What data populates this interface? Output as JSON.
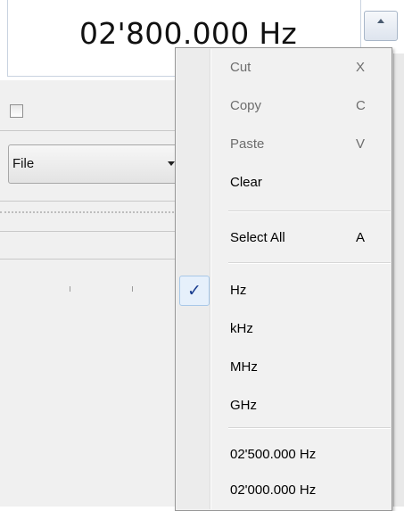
{
  "frequency_display": {
    "value": "02'800.000 Hz"
  },
  "file_combo": {
    "label": "File"
  },
  "context_menu": {
    "items_edit": [
      {
        "label": "Cut",
        "shortcut": "X",
        "enabled": false
      },
      {
        "label": "Copy",
        "shortcut": "C",
        "enabled": false
      },
      {
        "label": "Paste",
        "shortcut": "V",
        "enabled": false
      },
      {
        "label": "Clear",
        "shortcut": "",
        "enabled": true
      }
    ],
    "select_all": {
      "label": "Select All",
      "shortcut": "A"
    },
    "units": [
      {
        "label": "Hz",
        "checked": true
      },
      {
        "label": "kHz",
        "checked": false
      },
      {
        "label": "MHz",
        "checked": false
      },
      {
        "label": "GHz",
        "checked": false
      }
    ],
    "presets": [
      {
        "label": "02'500.000 Hz"
      },
      {
        "label": "02'000.000 Hz"
      }
    ],
    "check_glyph": "✓"
  },
  "colors": {
    "menu_background": "#f1f1f1",
    "check_highlight": "#e6f0fb",
    "check_mark": "#1a3d8f",
    "disabled_text": "#6d6d6d"
  },
  "icons": {
    "spin_up": "up-arrow-icon",
    "combo": "chevron-down-icon",
    "check": "checkmark-icon"
  }
}
